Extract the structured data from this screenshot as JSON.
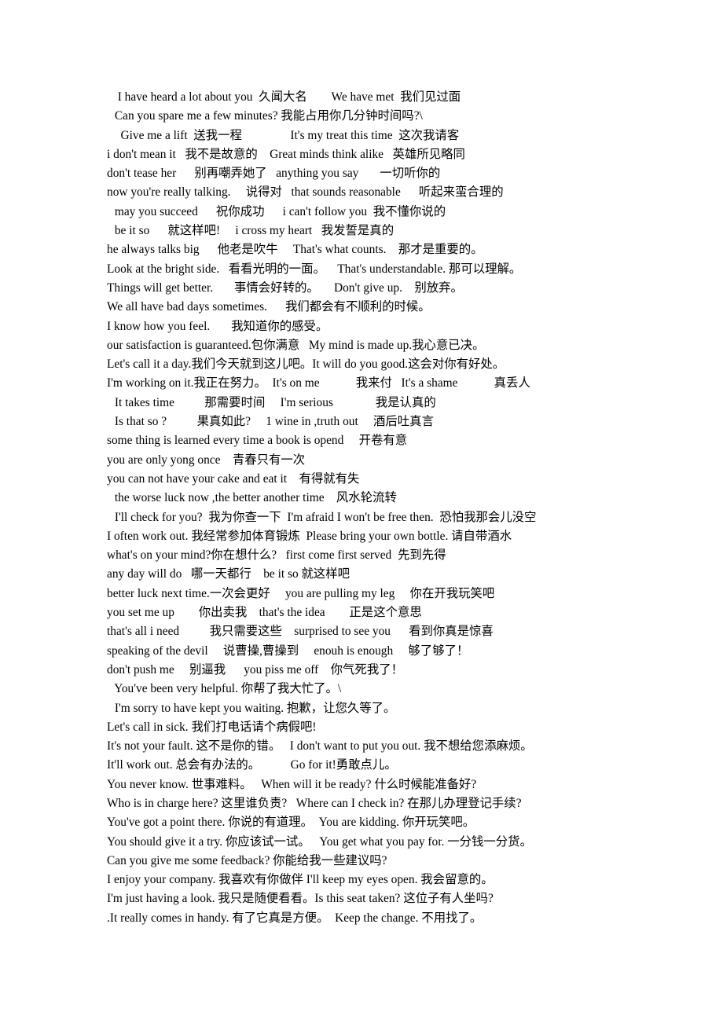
{
  "document": {
    "type": "plain-text-phrasebook",
    "background_color": "#ffffff",
    "text_color": "#000000",
    "lines": [
      {
        "text": "  I have heard a lot about you  久闻大名        We have met  我们见过面",
        "indent": "ind-1"
      },
      {
        "text": " Can you spare me a few minutes? 我能占用你几分钟时间吗?\\",
        "indent": "ind-1"
      },
      {
        "text": "   Give me a lift  送我一程                It's my treat this time  这次我请客",
        "indent": "ind-1"
      },
      {
        "text": "i don't mean it   我不是故意的    Great minds think alike   英雄所见略同",
        "indent": "ind-3"
      },
      {
        "text": "don't tease her      别再嘲弄她了   anything you say       一切听你的",
        "indent": "ind-3"
      },
      {
        "text": "now you're really talking.     说得对   that sounds reasonable      听起来蛮合理的",
        "indent": "ind-3"
      },
      {
        "text": " may you succeed      祝你成功      i can't follow you  我不懂你说的",
        "indent": "ind-1"
      },
      {
        "text": " be it so      就这样吧!     i cross my heart   我发誓是真的",
        "indent": "ind-1"
      },
      {
        "text": "he always talks big      他老是吹牛     That's what counts.    那才是重要的。",
        "indent": "ind-3"
      },
      {
        "text": "Look at the bright side.   看看光明的一面。    That's understandable. 那可以理解。",
        "indent": "ind-3"
      },
      {
        "text": "Things will get better.       事情会好转的。     Don't give up.    别放弃。",
        "indent": "ind-3"
      },
      {
        "text": "We all have bad days sometimes.      我们都会有不顺利的时候。",
        "indent": "ind-3"
      },
      {
        "text": "I know how you feel.       我知道你的感受。",
        "indent": "ind-3"
      },
      {
        "text": "our satisfaction is guaranteed.包你满意   My mind is made up.我心意已决。",
        "indent": "ind-3"
      },
      {
        "text": "Let's call it a day.我们今天就到这儿吧。It will do you good.这会对你有好处。",
        "indent": "ind-3"
      },
      {
        "text": "I'm working on it.我正在努力。  It's on me            我来付   It's a shame            真丢人",
        "indent": "ind-3"
      },
      {
        "text": " It takes time          那需要时间     I'm serious              我是认真的",
        "indent": "ind-1"
      },
      {
        "text": " Is that so ?          果真如此?     1 wine in ,truth out     酒后吐真言",
        "indent": "ind-1"
      },
      {
        "text": "some thing is learned every time a book is opend     开卷有意",
        "indent": "ind-3"
      },
      {
        "text": "you are only yong once    青春只有一次",
        "indent": "ind-3"
      },
      {
        "text": "you can not have your cake and eat it    有得就有失",
        "indent": "ind-3"
      },
      {
        "text": " the worse luck now ,the better another time    风水轮流转",
        "indent": "ind-1"
      },
      {
        "text": " I'll check for you?  我为你查一下  I'm afraid I won't be free then.  恐怕我那会儿没空",
        "indent": "ind-1"
      },
      {
        "text": "I often work out. 我经常参加体育锻炼  Please bring your own bottle. 请自带酒水",
        "indent": "ind-3"
      },
      {
        "text": "what's on your mind?你在想什么?   first come first served  先到先得",
        "indent": "ind-3"
      },
      {
        "text": "any day will do   哪一天都行    be it so 就这样吧",
        "indent": "ind-3"
      },
      {
        "text": "better luck next time.一次会更好     you are pulling my leg     你在开我玩笑吧",
        "indent": "ind-3"
      },
      {
        "text": "you set me up        你出卖我    that's the idea        正是这个意思",
        "indent": "ind-3"
      },
      {
        "text": "that's all i need          我只需要这些    surprised to see you      看到你真是惊喜",
        "indent": "ind-3"
      },
      {
        "text": "speaking of the devil     说曹操,曹操到     enouh is enough     够了够了！",
        "indent": "ind-3"
      },
      {
        "text": "don't push me     别逼我      you piss me off    你气死我了！",
        "indent": "ind-3"
      },
      {
        "text": " You've been very helpful. 你帮了我大忙了。\\",
        "indent": "ind-1"
      },
      {
        "text": " I'm sorry to have kept you waiting. 抱歉，让您久等了。",
        "indent": "ind-1"
      },
      {
        "text": "Let's call in sick. 我们打电话请个病假吧!",
        "indent": "ind-3"
      },
      {
        "text": "It's not your fault. 这不是你的错。   I don't want to put you out. 我不想给您添麻烦。",
        "indent": "ind-3"
      },
      {
        "text": "It'll work out. 总会有办法的。          Go for it!勇敢点儿。",
        "indent": "ind-3"
      },
      {
        "text": "You never know. 世事难料。   When will it be ready? 什么时候能准备好?",
        "indent": "ind-3"
      },
      {
        "text": "Who is in charge here? 这里谁负责?   Where can I check in? 在那儿办理登记手续?",
        "indent": "ind-3"
      },
      {
        "text": "You've got a point there. 你说的有道理。  You are kidding. 你开玩笑吧。",
        "indent": "ind-3"
      },
      {
        "text": "You should give it a try. 你应该试一试。   You get what you pay for. 一分钱一分货。",
        "indent": "ind-3"
      },
      {
        "text": "Can you give me some feedback? 你能给我一些建议吗?",
        "indent": "ind-3"
      },
      {
        "text": "I enjoy your company. 我喜欢有你做伴 I'll keep my eyes open. 我会留意的。",
        "indent": "ind-3"
      },
      {
        "text": "I'm just having a look. 我只是随便看看。Is this seat taken? 这位子有人坐吗?",
        "indent": "ind-3"
      },
      {
        "text": ".It really comes in handy. 有了它真是方便。  Keep the change. 不用找了。",
        "indent": "ind-3"
      }
    ]
  }
}
